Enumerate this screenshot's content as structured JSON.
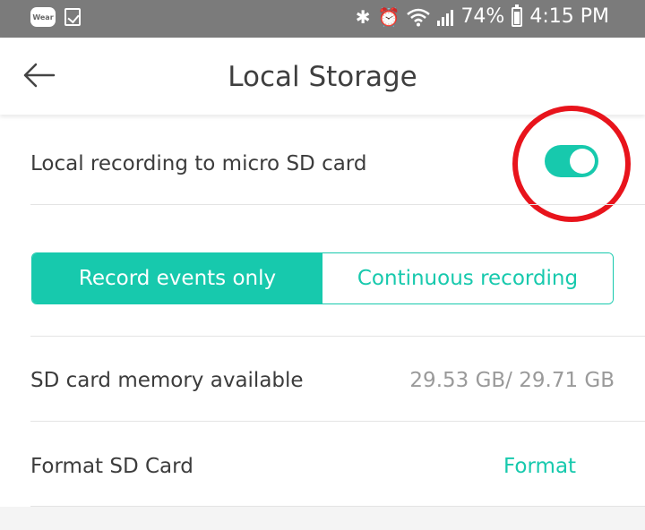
{
  "status_bar": {
    "wear_label": "Wear",
    "battery_percent": "74%",
    "battery_level": 0.74,
    "time": "4:15 PM",
    "icons": [
      "bluetooth-icon",
      "alarm-icon",
      "wifi-icon",
      "signal-icon",
      "battery-icon"
    ]
  },
  "header": {
    "title": "Local Storage",
    "back_icon": "back-arrow-icon"
  },
  "local_recording": {
    "label": "Local recording to micro SD card",
    "enabled": true
  },
  "recording_mode": {
    "options": [
      "Record events only",
      "Continuous recording"
    ],
    "selected": "Record events only"
  },
  "memory": {
    "label": "SD card memory available",
    "value": "29.53 GB/ 29.71 GB"
  },
  "format": {
    "label": "Format SD Card",
    "action": "Format"
  },
  "colors": {
    "accent": "#17c9ad",
    "highlight": "#e8141c",
    "status_bar": "#7b7b7b"
  }
}
